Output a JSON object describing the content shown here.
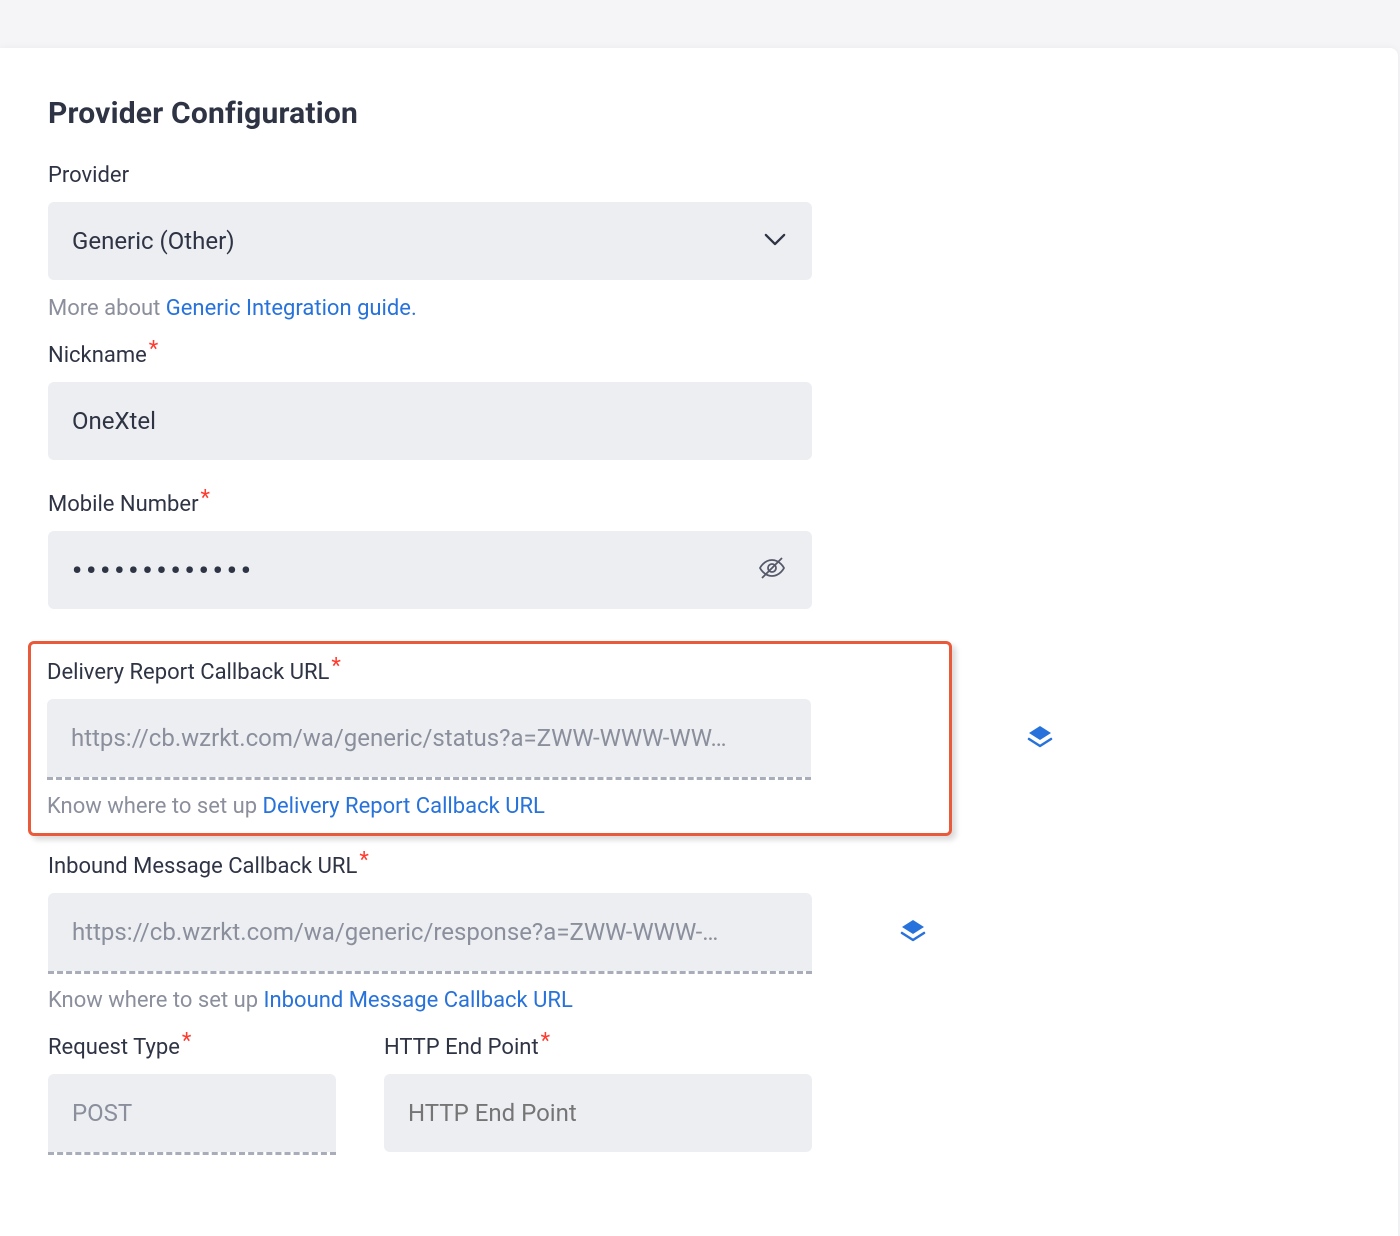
{
  "page": {
    "title": "Provider Configuration"
  },
  "fields": {
    "provider": {
      "label": "Provider",
      "value": "Generic (Other)",
      "help_prefix": "More about ",
      "help_link": "Generic Integration guide."
    },
    "nickname": {
      "label": "Nickname",
      "value": "OneXtel"
    },
    "mobile": {
      "label": "Mobile Number",
      "value": "•••••••••••••"
    },
    "delivery": {
      "label": "Delivery Report Callback URL",
      "value": "https://cb.wzrkt.com/wa/generic/status?a=ZWW-WWW-WW…",
      "know_prefix": "Know where to set up ",
      "know_link": "Delivery Report Callback URL"
    },
    "inbound": {
      "label": "Inbound Message Callback URL",
      "value": "https://cb.wzrkt.com/wa/generic/response?a=ZWW-WWW-…",
      "know_prefix": "Know where to set up ",
      "know_link": "Inbound Message Callback URL"
    },
    "request_type": {
      "label": "Request Type",
      "value": "POST"
    },
    "http_endpoint": {
      "label": "HTTP End Point",
      "placeholder": "HTTP End Point"
    }
  }
}
